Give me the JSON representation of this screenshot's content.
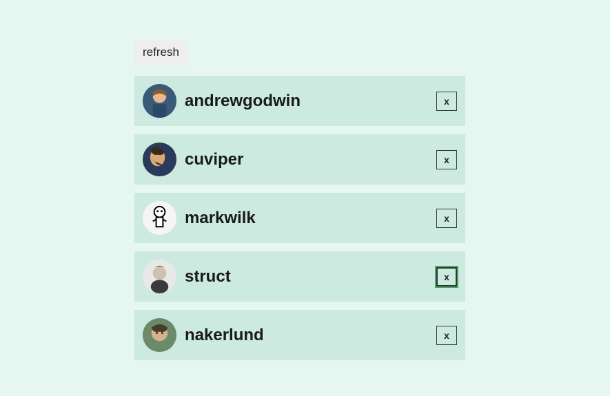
{
  "controls": {
    "refresh_label": "refresh"
  },
  "close_label": "x",
  "users": [
    {
      "username": "andrewgodwin",
      "focused": false
    },
    {
      "username": "cuviper",
      "focused": false
    },
    {
      "username": "markwilk",
      "focused": false
    },
    {
      "username": "struct",
      "focused": true
    },
    {
      "username": "nakerlund",
      "focused": false
    }
  ]
}
